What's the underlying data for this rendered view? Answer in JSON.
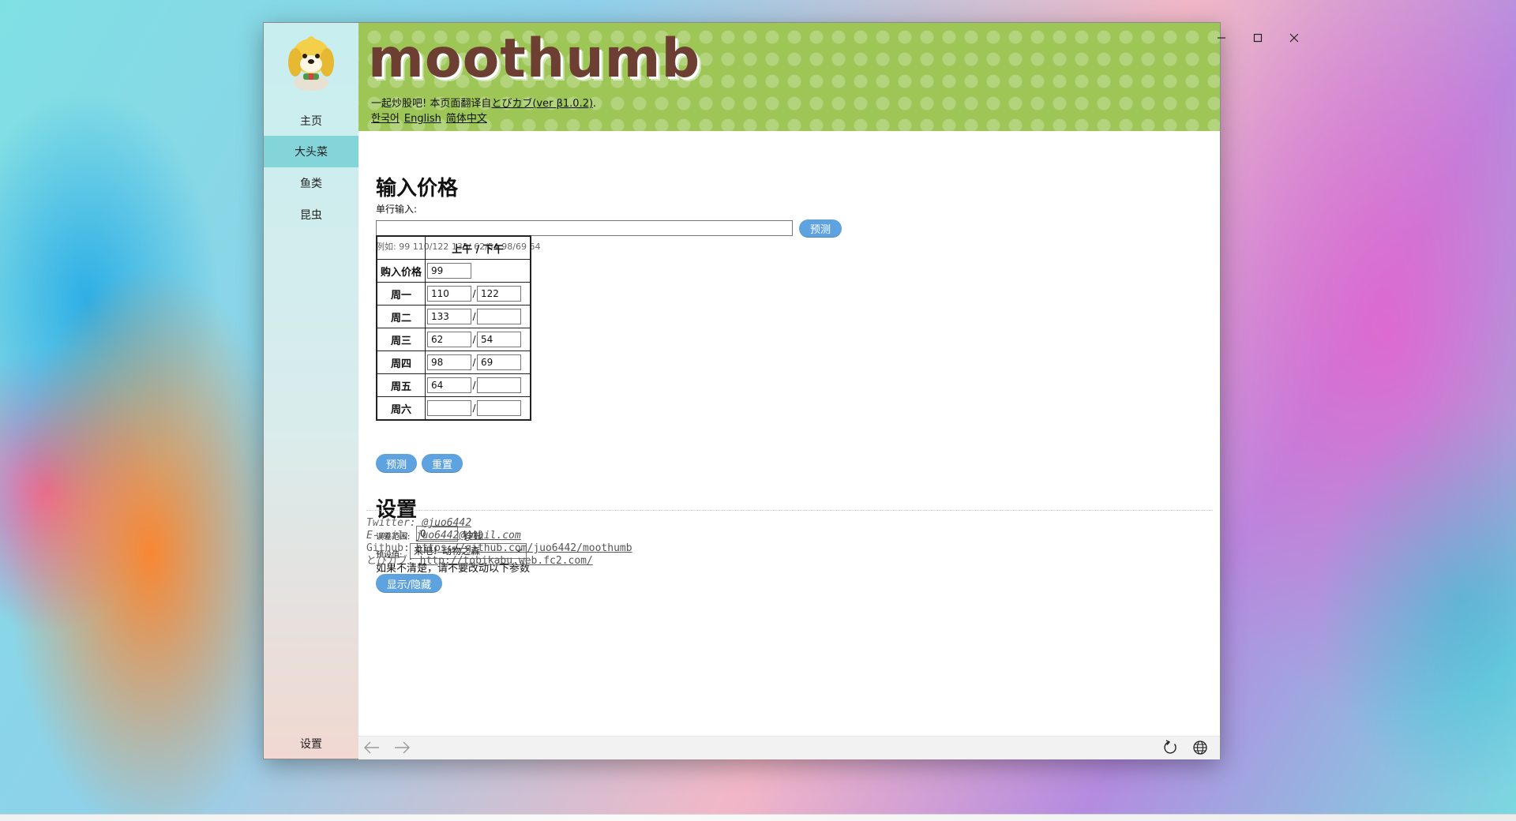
{
  "window": {
    "controls": {
      "minimize": "—",
      "maximize": "☐",
      "close": "✕"
    }
  },
  "sidebar": {
    "avatar_icon": "isabelle-dog-icon",
    "items": [
      {
        "label": "主页",
        "active": false
      },
      {
        "label": "大头菜",
        "active": true
      },
      {
        "label": "鱼类",
        "active": false
      },
      {
        "label": "昆虫",
        "active": false
      }
    ],
    "settings_label": "设置"
  },
  "header": {
    "title": "moothumb",
    "subtitle_prefix": "一起炒股吧! 本页面翻译自",
    "subtitle_link": "とびカブ(ver β1.0.2)",
    "subtitle_suffix": ".",
    "languages": [
      "한국어",
      "English",
      "简体中文"
    ],
    "background_color": "#9dc657",
    "title_color": "#6d3f33"
  },
  "input_section": {
    "title": "输入价格",
    "single_line_label": "单行输入:",
    "single_line_value": "",
    "predict_label": "预测",
    "example": "例如: 99 110/122 133/ 62/54 98/69 64",
    "table": {
      "header": "上午 / 下午",
      "separator": "/",
      "buy_label": "购入价格",
      "buy_value": "99",
      "rows": [
        {
          "day": "周一",
          "am": "110",
          "pm": "122"
        },
        {
          "day": "周二",
          "am": "133",
          "pm": ""
        },
        {
          "day": "周三",
          "am": "62",
          "pm": "54"
        },
        {
          "day": "周四",
          "am": "98",
          "pm": "69"
        },
        {
          "day": "周五",
          "am": "64",
          "pm": ""
        },
        {
          "day": "周六",
          "am": "",
          "pm": ""
        }
      ]
    },
    "predict_button": "预测",
    "reset_button": "重置"
  },
  "settings_section": {
    "title": "设置",
    "error_range_label": "误差范围:",
    "error_range_value": "0",
    "error_range_unit": "铃钱",
    "preset_label": "预设值:",
    "preset_value": "来吧！动物之森",
    "warning": "如果不清楚，请不要改动以下参数",
    "toggle_button": "显示/隐藏"
  },
  "footer": {
    "twitter_label": "Twitter: ",
    "twitter_value": "@juo6442",
    "email_label": "E-mail: ",
    "email_value": "juo6442@gmail.com",
    "github_label": "Github: ",
    "github_value": "https://github.com/juo6442/moothumb",
    "tobikabu_label": "とびカブ: ",
    "tobikabu_value": "http://tobikabu.web.fc2.com/"
  },
  "bottom_bar": {
    "back_icon": "arrow-left-icon",
    "forward_icon": "arrow-right-icon",
    "refresh_icon": "refresh-icon",
    "globe_icon": "globe-icon"
  },
  "colors": {
    "accent_button": "#5ea3e0",
    "active_nav": "#84d5d9"
  }
}
